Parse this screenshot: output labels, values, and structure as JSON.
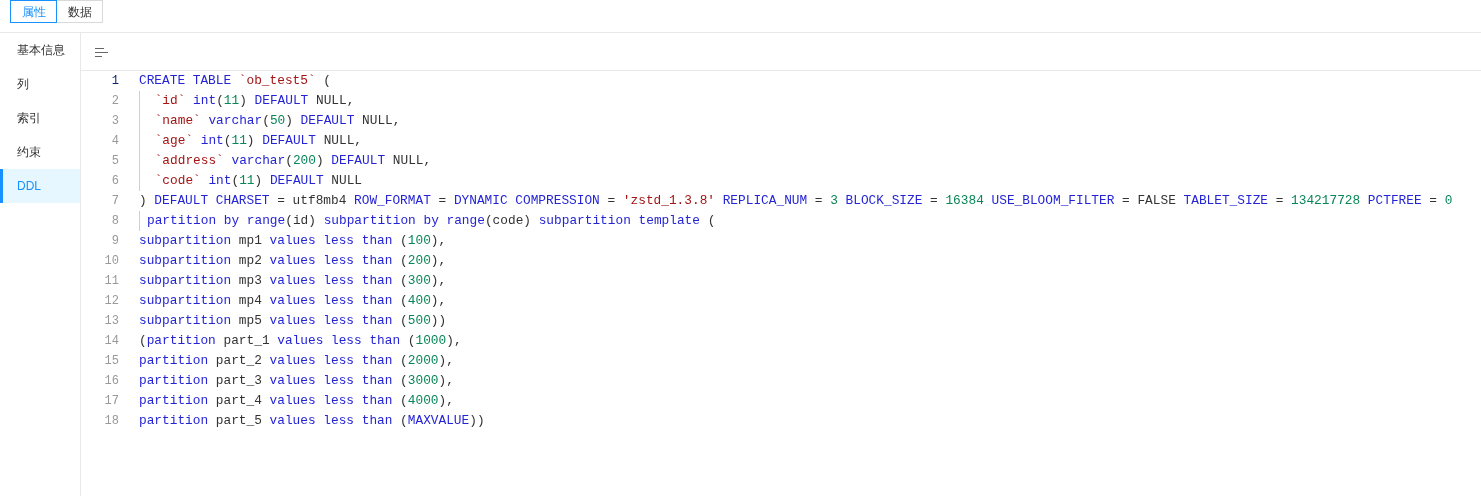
{
  "tabs": [
    {
      "label": "属性",
      "selected": true
    },
    {
      "label": "数据",
      "selected": false
    }
  ],
  "sidebar": {
    "items": [
      {
        "label": "基本信息",
        "selected": false
      },
      {
        "label": "列",
        "selected": false
      },
      {
        "label": "索引",
        "selected": false
      },
      {
        "label": "约束",
        "selected": false
      },
      {
        "label": "DDL",
        "selected": true
      }
    ]
  },
  "editor": {
    "lines": [
      {
        "number": "1",
        "current": true,
        "indented": false,
        "tokens": [
          {
            "kind": "kw",
            "t": "CREATE TABLE"
          },
          {
            "kind": "str",
            "t": " `ob_test5`"
          },
          {
            "kind": "plain",
            "t": " ("
          }
        ]
      },
      {
        "number": "2",
        "current": false,
        "indented": true,
        "tokens": [
          {
            "kind": "str",
            "t": " `id`"
          },
          {
            "kind": "kw",
            "t": " int"
          },
          {
            "kind": "plain",
            "t": "("
          },
          {
            "kind": "num",
            "t": "11"
          },
          {
            "kind": "plain",
            "t": ") "
          },
          {
            "kind": "kw",
            "t": "DEFAULT"
          },
          {
            "kind": "plain",
            "t": " NULL,"
          }
        ]
      },
      {
        "number": "3",
        "current": false,
        "indented": true,
        "tokens": [
          {
            "kind": "str",
            "t": " `name`"
          },
          {
            "kind": "kw",
            "t": " varchar"
          },
          {
            "kind": "plain",
            "t": "("
          },
          {
            "kind": "num",
            "t": "50"
          },
          {
            "kind": "plain",
            "t": ") "
          },
          {
            "kind": "kw",
            "t": "DEFAULT"
          },
          {
            "kind": "plain",
            "t": " NULL,"
          }
        ]
      },
      {
        "number": "4",
        "current": false,
        "indented": true,
        "tokens": [
          {
            "kind": "str",
            "t": " `age`"
          },
          {
            "kind": "kw",
            "t": " int"
          },
          {
            "kind": "plain",
            "t": "("
          },
          {
            "kind": "num",
            "t": "11"
          },
          {
            "kind": "plain",
            "t": ") "
          },
          {
            "kind": "kw",
            "t": "DEFAULT"
          },
          {
            "kind": "plain",
            "t": " NULL,"
          }
        ]
      },
      {
        "number": "5",
        "current": false,
        "indented": true,
        "tokens": [
          {
            "kind": "str",
            "t": " `address`"
          },
          {
            "kind": "kw",
            "t": " varchar"
          },
          {
            "kind": "plain",
            "t": "("
          },
          {
            "kind": "num",
            "t": "200"
          },
          {
            "kind": "plain",
            "t": ") "
          },
          {
            "kind": "kw",
            "t": "DEFAULT"
          },
          {
            "kind": "plain",
            "t": " NULL,"
          }
        ]
      },
      {
        "number": "6",
        "current": false,
        "indented": true,
        "tokens": [
          {
            "kind": "str",
            "t": " `code`"
          },
          {
            "kind": "kw",
            "t": " int"
          },
          {
            "kind": "plain",
            "t": "("
          },
          {
            "kind": "num",
            "t": "11"
          },
          {
            "kind": "plain",
            "t": ") "
          },
          {
            "kind": "kw",
            "t": "DEFAULT"
          },
          {
            "kind": "plain",
            "t": " NULL"
          }
        ]
      },
      {
        "number": "7",
        "current": false,
        "indented": false,
        "tokens": [
          {
            "kind": "plain",
            "t": ") "
          },
          {
            "kind": "kw",
            "t": "DEFAULT CHARSET"
          },
          {
            "kind": "plain",
            "t": " = utf8mb4 "
          },
          {
            "kind": "kw",
            "t": "ROW_FORMAT"
          },
          {
            "kind": "plain",
            "t": " = "
          },
          {
            "kind": "kw",
            "t": "DYNAMIC COMPRESSION"
          },
          {
            "kind": "plain",
            "t": " = "
          },
          {
            "kind": "str",
            "t": "'zstd_1.3.8'"
          },
          {
            "kind": "kw",
            "t": " REPLICA_NUM"
          },
          {
            "kind": "plain",
            "t": " = "
          },
          {
            "kind": "num",
            "t": "3"
          },
          {
            "kind": "kw",
            "t": " BLOCK_SIZE"
          },
          {
            "kind": "plain",
            "t": " = "
          },
          {
            "kind": "num",
            "t": "16384"
          },
          {
            "kind": "kw",
            "t": " USE_BLOOM_FILTER"
          },
          {
            "kind": "plain",
            "t": " = FALSE "
          },
          {
            "kind": "kw",
            "t": "TABLET_SIZE"
          },
          {
            "kind": "plain",
            "t": " = "
          },
          {
            "kind": "num",
            "t": "134217728"
          },
          {
            "kind": "kw",
            "t": " PCTFREE"
          },
          {
            "kind": "plain",
            "t": " = "
          },
          {
            "kind": "num",
            "t": "0"
          }
        ]
      },
      {
        "number": "8",
        "current": false,
        "indented": true,
        "tokens": [
          {
            "kind": "kw",
            "t": "partition by range"
          },
          {
            "kind": "plain",
            "t": "(id) "
          },
          {
            "kind": "kw",
            "t": "subpartition by range"
          },
          {
            "kind": "plain",
            "t": "(code) "
          },
          {
            "kind": "kw",
            "t": "subpartition template"
          },
          {
            "kind": "plain",
            "t": " ("
          }
        ]
      },
      {
        "number": "9",
        "current": false,
        "indented": false,
        "tokens": [
          {
            "kind": "kw",
            "t": "subpartition"
          },
          {
            "kind": "plain",
            "t": " mp1 "
          },
          {
            "kind": "kw",
            "t": "values less than"
          },
          {
            "kind": "plain",
            "t": " ("
          },
          {
            "kind": "num",
            "t": "100"
          },
          {
            "kind": "plain",
            "t": "),"
          }
        ]
      },
      {
        "number": "10",
        "current": false,
        "indented": false,
        "tokens": [
          {
            "kind": "kw",
            "t": "subpartition"
          },
          {
            "kind": "plain",
            "t": " mp2 "
          },
          {
            "kind": "kw",
            "t": "values less than"
          },
          {
            "kind": "plain",
            "t": " ("
          },
          {
            "kind": "num",
            "t": "200"
          },
          {
            "kind": "plain",
            "t": "),"
          }
        ]
      },
      {
        "number": "11",
        "current": false,
        "indented": false,
        "tokens": [
          {
            "kind": "kw",
            "t": "subpartition"
          },
          {
            "kind": "plain",
            "t": " mp3 "
          },
          {
            "kind": "kw",
            "t": "values less than"
          },
          {
            "kind": "plain",
            "t": " ("
          },
          {
            "kind": "num",
            "t": "300"
          },
          {
            "kind": "plain",
            "t": "),"
          }
        ]
      },
      {
        "number": "12",
        "current": false,
        "indented": false,
        "tokens": [
          {
            "kind": "kw",
            "t": "subpartition"
          },
          {
            "kind": "plain",
            "t": " mp4 "
          },
          {
            "kind": "kw",
            "t": "values less than"
          },
          {
            "kind": "plain",
            "t": " ("
          },
          {
            "kind": "num",
            "t": "400"
          },
          {
            "kind": "plain",
            "t": "),"
          }
        ]
      },
      {
        "number": "13",
        "current": false,
        "indented": false,
        "tokens": [
          {
            "kind": "kw",
            "t": "subpartition"
          },
          {
            "kind": "plain",
            "t": " mp5 "
          },
          {
            "kind": "kw",
            "t": "values less than"
          },
          {
            "kind": "plain",
            "t": " ("
          },
          {
            "kind": "num",
            "t": "500"
          },
          {
            "kind": "plain",
            "t": "))"
          }
        ]
      },
      {
        "number": "14",
        "current": false,
        "indented": false,
        "tokens": [
          {
            "kind": "plain",
            "t": "("
          },
          {
            "kind": "kw",
            "t": "partition"
          },
          {
            "kind": "plain",
            "t": " part_1 "
          },
          {
            "kind": "kw",
            "t": "values less than"
          },
          {
            "kind": "plain",
            "t": " ("
          },
          {
            "kind": "num",
            "t": "1000"
          },
          {
            "kind": "plain",
            "t": "),"
          }
        ]
      },
      {
        "number": "15",
        "current": false,
        "indented": false,
        "tokens": [
          {
            "kind": "kw",
            "t": "partition"
          },
          {
            "kind": "plain",
            "t": " part_2 "
          },
          {
            "kind": "kw",
            "t": "values less than"
          },
          {
            "kind": "plain",
            "t": " ("
          },
          {
            "kind": "num",
            "t": "2000"
          },
          {
            "kind": "plain",
            "t": "),"
          }
        ]
      },
      {
        "number": "16",
        "current": false,
        "indented": false,
        "tokens": [
          {
            "kind": "kw",
            "t": "partition"
          },
          {
            "kind": "plain",
            "t": " part_3 "
          },
          {
            "kind": "kw",
            "t": "values less than"
          },
          {
            "kind": "plain",
            "t": " ("
          },
          {
            "kind": "num",
            "t": "3000"
          },
          {
            "kind": "plain",
            "t": "),"
          }
        ]
      },
      {
        "number": "17",
        "current": false,
        "indented": false,
        "tokens": [
          {
            "kind": "kw",
            "t": "partition"
          },
          {
            "kind": "plain",
            "t": " part_4 "
          },
          {
            "kind": "kw",
            "t": "values less than"
          },
          {
            "kind": "plain",
            "t": " ("
          },
          {
            "kind": "num",
            "t": "4000"
          },
          {
            "kind": "plain",
            "t": "),"
          }
        ]
      },
      {
        "number": "18",
        "current": false,
        "indented": false,
        "tokens": [
          {
            "kind": "kw",
            "t": "partition"
          },
          {
            "kind": "plain",
            "t": " part_5 "
          },
          {
            "kind": "kw",
            "t": "values less than"
          },
          {
            "kind": "plain",
            "t": " ("
          },
          {
            "kind": "kw",
            "t": "MAXVALUE"
          },
          {
            "kind": "plain",
            "t": "))"
          }
        ]
      }
    ]
  }
}
